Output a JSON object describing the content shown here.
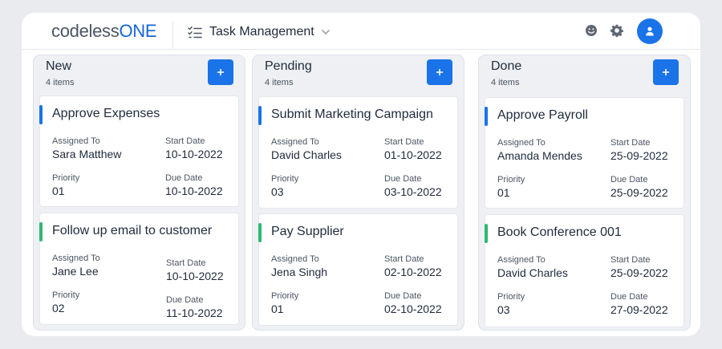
{
  "header": {
    "logo_main": "codeless",
    "logo_accent": "ONE",
    "app_title": "Task Management"
  },
  "colors": {
    "accent": "#1a73e8",
    "bar_blue": "#1a73e8",
    "bar_green": "#2eb872"
  },
  "icons": [
    "task-list-icon",
    "chevron-down-icon",
    "smiley-icon",
    "gear-icon",
    "user-icon",
    "plus-icon"
  ],
  "columns": [
    {
      "title": "New",
      "count": "4 items",
      "cards": [
        {
          "title": "Approve Expenses",
          "bar": "blue",
          "assigned_label": "Assigned To",
          "assigned": "Sara Matthew",
          "start_label": "Start Date",
          "start": "10-10-2022",
          "priority_label": "Priority",
          "priority": "01",
          "due_label": "Due Date",
          "due": "10-10-2022"
        },
        {
          "title": "Follow up email to customer",
          "bar": "green",
          "assigned_label": "Assigned To",
          "assigned": "Jane Lee",
          "start_label": "Start Date",
          "start": "10-10-2022",
          "priority_label": "Priority",
          "priority": "02",
          "due_label": "Due Date",
          "due": "11-10-2022"
        }
      ]
    },
    {
      "title": "Pending",
      "count": "4 items",
      "cards": [
        {
          "title": "Submit Marketing Campaign",
          "bar": "blue",
          "assigned_label": "Assigned To",
          "assigned": "David Charles",
          "start_label": "Start Date",
          "start": "01-10-2022",
          "priority_label": "Priority",
          "priority": "03",
          "due_label": "Due Date",
          "due": "03-10-2022"
        },
        {
          "title": "Pay Supplier",
          "bar": "green",
          "assigned_label": "Assigned To",
          "assigned": "Jena Singh",
          "start_label": "Start Date",
          "start": "02-10-2022",
          "priority_label": "Priority",
          "priority": "01",
          "due_label": "Due Date",
          "due": "02-10-2022"
        }
      ]
    },
    {
      "title": "Done",
      "count": "4 items",
      "cards": [
        {
          "title": "Approve Payroll",
          "bar": "blue",
          "assigned_label": "Assigned To",
          "assigned": "Amanda Mendes",
          "start_label": "Start Date",
          "start": "25-09-2022",
          "priority_label": "Priority",
          "priority": "01",
          "due_label": "Due Date",
          "due": "25-09-2022"
        },
        {
          "title": "Book Conference 001",
          "bar": "green",
          "assigned_label": "Assigned To",
          "assigned": "David Charles",
          "start_label": "Start Date",
          "start": "25-09-2022",
          "priority_label": "Priority",
          "priority": "03",
          "due_label": "Due Date",
          "due": "27-09-2022"
        }
      ]
    }
  ]
}
